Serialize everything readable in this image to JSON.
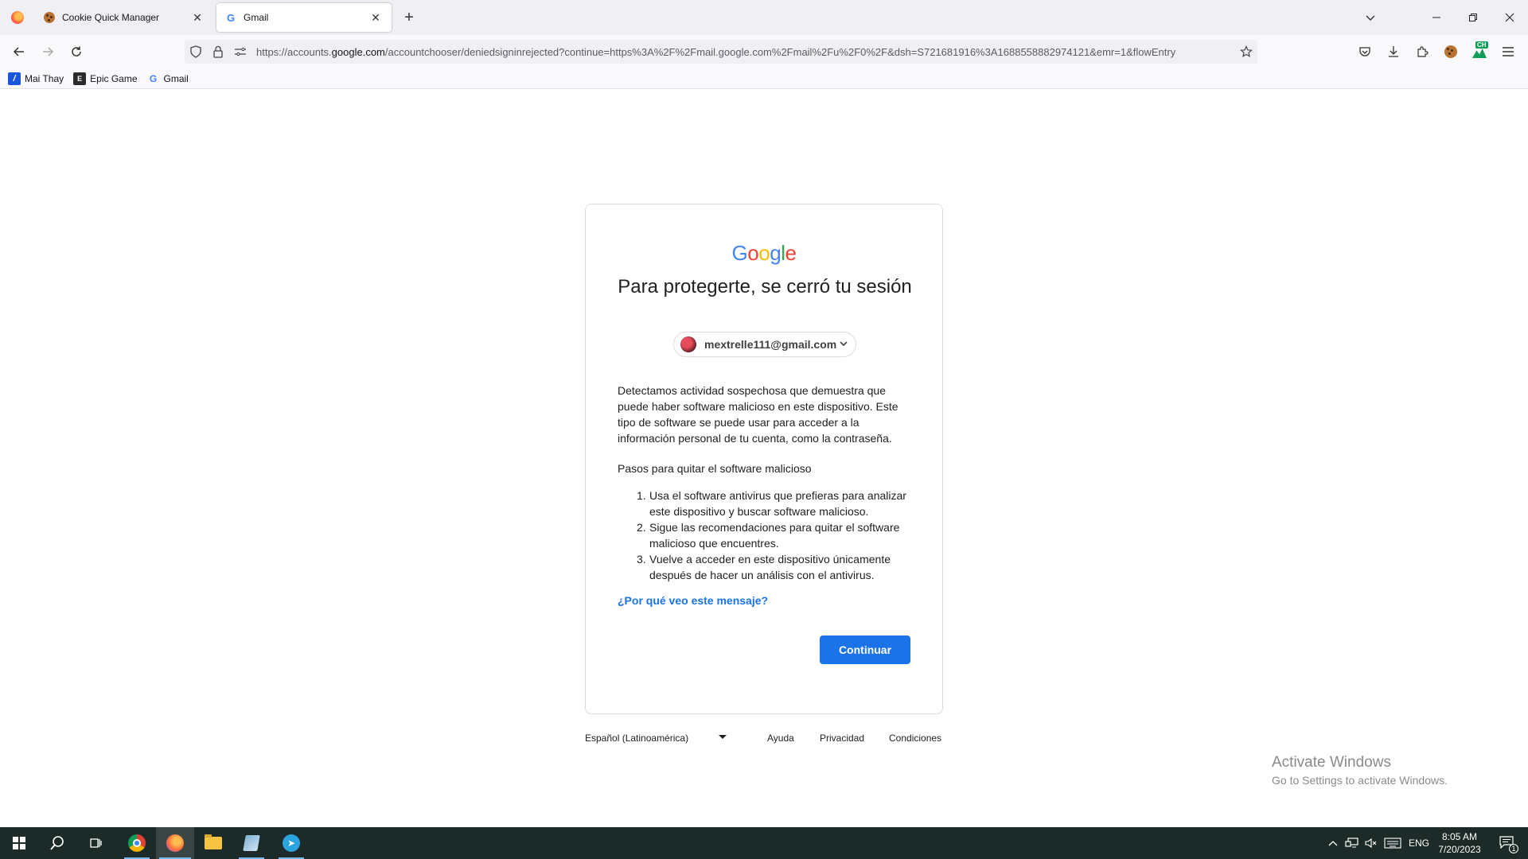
{
  "browser": {
    "tabs": [
      {
        "title": "Cookie Quick Manager",
        "active": false
      },
      {
        "title": "Gmail",
        "active": true
      }
    ],
    "url_prefix": "https://accounts.",
    "url_host": "google.com",
    "url_rest": "/accountchooser/deniedsigninrejected?continue=https%3A%2F%2Fmail.google.com%2Fmail%2Fu%2F0%2F&dsh=S721681916%3A1688558882974121&emr=1&flowEntry",
    "bookmarks": [
      {
        "label": "Mai Thay",
        "icon": "bookmark-mt-icon"
      },
      {
        "label": "Epic Game",
        "icon": "epic-games-icon"
      },
      {
        "label": "Gmail",
        "icon": "google-g-icon"
      }
    ],
    "extension_badge": "CH"
  },
  "page": {
    "logo_text": "Google",
    "title": "Para protegerte, se cerró tu sesión",
    "account_email": "mextrelle111@gmail.com",
    "paragraph": "Detectamos actividad sospechosa que demuestra que puede haber software malicioso en este dispositivo. Este tipo de software se puede usar para acceder a la información personal de tu cuenta, como la contraseña.",
    "steps_heading": "Pasos para quitar el software malicioso",
    "steps": [
      {
        "num": "1.",
        "text": "Usa el software antivirus que prefieras para analizar este dispositivo y buscar software malicioso."
      },
      {
        "num": "2.",
        "text": "Sigue las recomendaciones para quitar el software malicioso que encuentres."
      },
      {
        "num": "3.",
        "text": "Vuelve a acceder en este dispositivo únicamente después de hacer un análisis con el antivirus."
      }
    ],
    "why_link": "¿Por qué veo este mensaje?",
    "continue_button": "Continuar"
  },
  "footer": {
    "language": "Español (Latinoamérica)",
    "help": "Ayuda",
    "privacy": "Privacidad",
    "terms": "Condiciones"
  },
  "watermark": {
    "line1": "Activate Windows",
    "line2": "Go to Settings to activate Windows."
  },
  "taskbar": {
    "language": "ENG",
    "time": "8:05 AM",
    "date": "7/20/2023",
    "notifications": "1"
  },
  "colors": {
    "accent_blue": "#1a73e8",
    "taskbar_bg": "#1d2b28"
  }
}
